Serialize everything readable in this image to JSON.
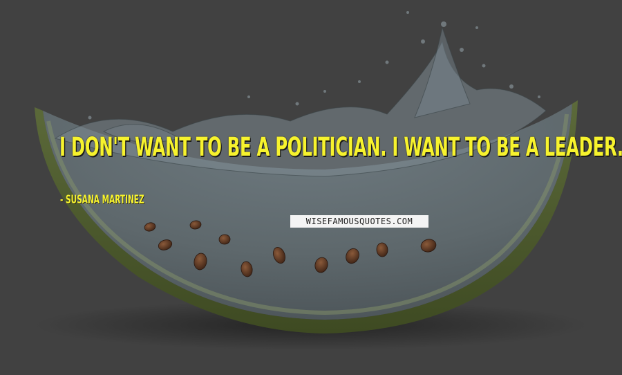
{
  "quote": {
    "text": "I don't want to be a politician. I want to be a leader.",
    "author": "- Susana Martinez",
    "text_color": "#f7f32d"
  },
  "watermark": {
    "text": "WISEFAMOUSQUOTES.COM"
  },
  "background": {
    "color": "#414141",
    "picture": "watermelon-slice-with-water-splash"
  }
}
